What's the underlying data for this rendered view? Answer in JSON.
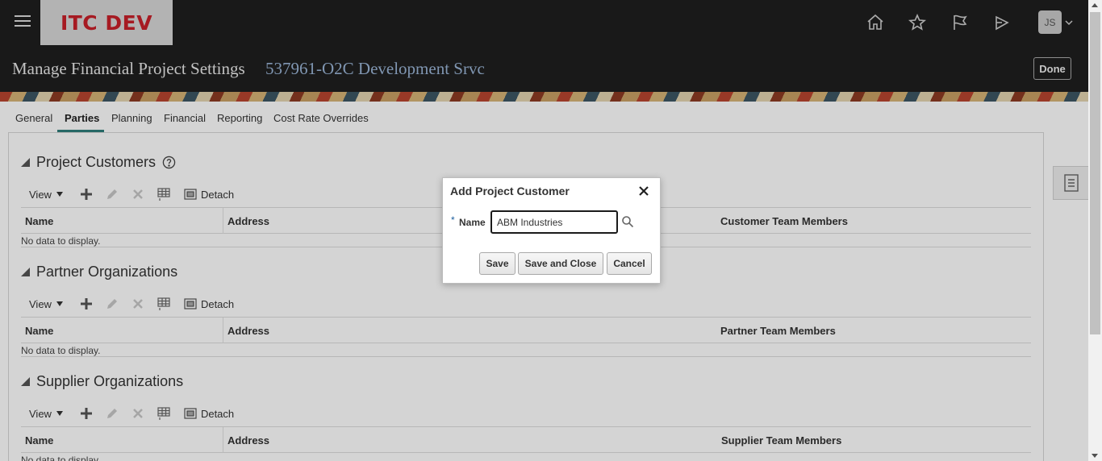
{
  "header": {
    "logo_text": "ITC DEV",
    "page_title": "Manage Financial Project Settings",
    "page_subtitle": "537961-O2C Development Srvc",
    "done_label": "Done",
    "user_initials": "JS"
  },
  "tabs": [
    {
      "label": "General"
    },
    {
      "label": "Parties",
      "active": true
    },
    {
      "label": "Planning"
    },
    {
      "label": "Financial"
    },
    {
      "label": "Reporting"
    },
    {
      "label": "Cost Rate Overrides"
    }
  ],
  "toolbar": {
    "view_label": "View",
    "detach_label": "Detach"
  },
  "sections": [
    {
      "title": "Project Customers",
      "columns": [
        "Name",
        "Address",
        "Customer Team Members"
      ],
      "empty_text": "No data to display."
    },
    {
      "title": "Partner Organizations",
      "columns": [
        "Name",
        "Address",
        "Partner Team Members"
      ],
      "empty_text": "No data to display."
    },
    {
      "title": "Supplier Organizations",
      "columns": [
        "Name",
        "Address",
        "Supplier Team Members"
      ],
      "empty_text": "No data to display."
    }
  ],
  "dialog": {
    "title": "Add Project Customer",
    "required_marker": "*",
    "name_label": "Name",
    "name_value": "ABM Industries",
    "save_label": "Save",
    "save_close_label": "Save and Close",
    "cancel_label": "Cancel"
  },
  "colors": {
    "header_bg": "#1f1f1f",
    "logo_red": "#c8202a",
    "subtitle_blue": "#9ab5d6",
    "tab_accent": "#2f7d7b"
  }
}
